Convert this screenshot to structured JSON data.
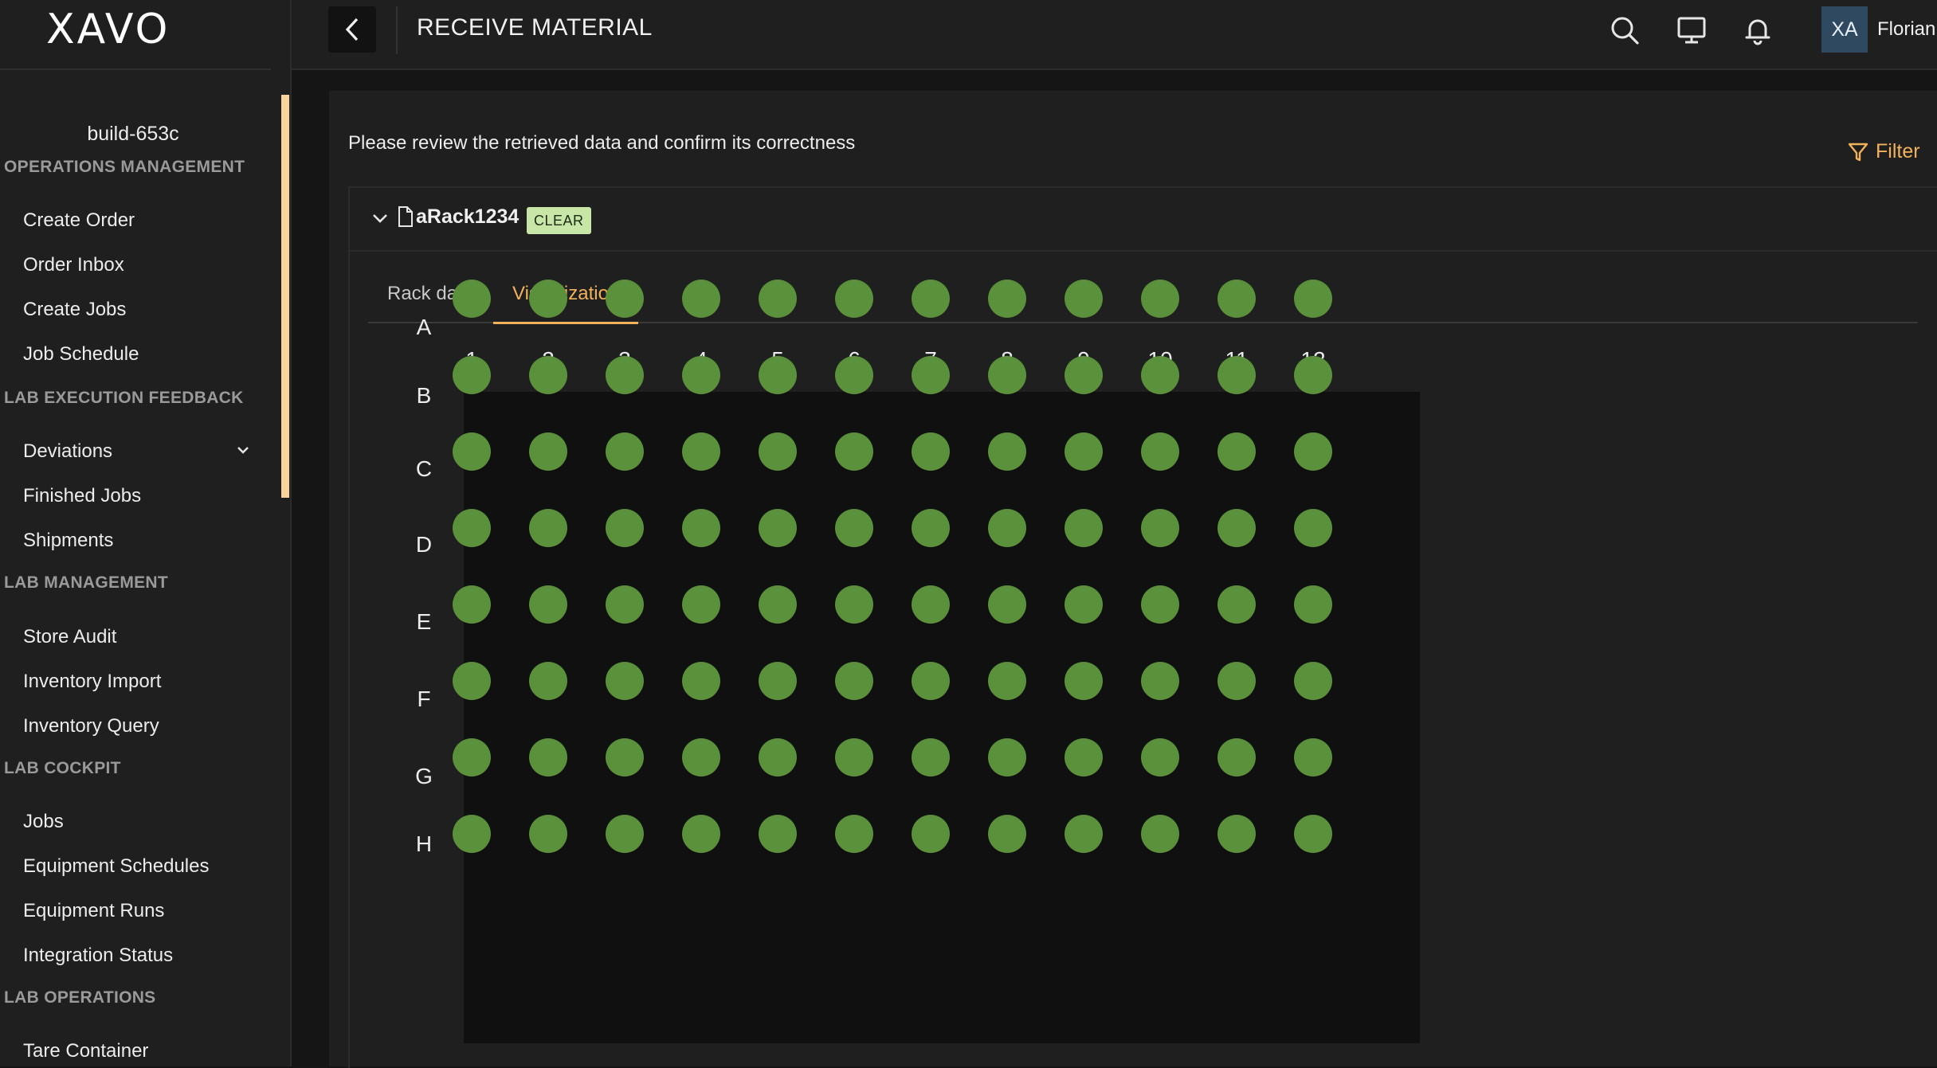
{
  "app": {
    "logo": "XAVO",
    "build": "build-653c"
  },
  "sidebar": {
    "sections": [
      {
        "title": "OPERATIONS MANAGEMENT",
        "items": [
          "Create Order",
          "Order Inbox",
          "Create Jobs",
          "Job Schedule"
        ]
      },
      {
        "title": "LAB EXECUTION FEEDBACK",
        "items": [
          "Deviations",
          "Finished Jobs",
          "Shipments"
        ]
      },
      {
        "title": "LAB MANAGEMENT",
        "items": [
          "Store Audit",
          "Inventory Import",
          "Inventory Query"
        ]
      },
      {
        "title": "LAB COCKPIT",
        "items": [
          "Jobs",
          "Equipment Schedules",
          "Equipment Runs",
          "Integration Status"
        ]
      },
      {
        "title": "LAB OPERATIONS",
        "items": [
          "Tare Container"
        ]
      }
    ]
  },
  "header": {
    "title": "RECEIVE MATERIAL",
    "icons": [
      "back-icon",
      "search-icon",
      "monitor-icon",
      "bell-icon"
    ],
    "avatar_initials": "XA",
    "user_name": "Florian"
  },
  "main": {
    "review_message": "Please review the retrieved data and confirm its correctness",
    "filter_label": "Filter",
    "rack": {
      "name": "aRack1234",
      "status_badge": "CLEAR",
      "tabs": [
        "Rack data",
        "Visualization"
      ],
      "active_tab": "Visualization"
    },
    "plate": {
      "columns": [
        "1",
        "2",
        "3",
        "4",
        "5",
        "6",
        "7",
        "8",
        "9",
        "10",
        "11",
        "12"
      ],
      "rows": [
        "A",
        "B",
        "C",
        "D",
        "E",
        "F",
        "G",
        "H"
      ],
      "well_color": "#5a913a",
      "well_state": "filled"
    }
  },
  "colors": {
    "accent": "#f2b25a",
    "badge_bg": "#c7e6a8",
    "sidebar_scroll_accent": "#f8d49a",
    "avatar_bg": "#2f4a60"
  }
}
